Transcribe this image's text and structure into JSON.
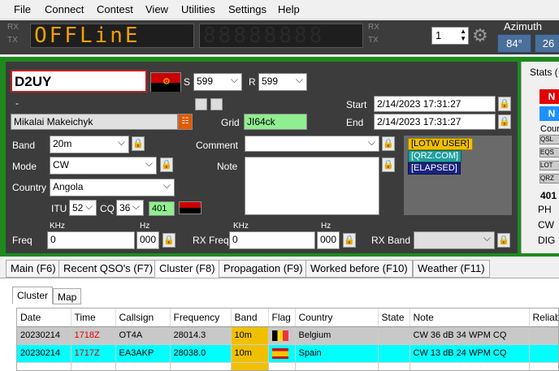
{
  "menu": [
    "File",
    "Connect",
    "Contest",
    "View",
    "Utilities",
    "Settings",
    "Help"
  ],
  "top": {
    "rx": "RX",
    "tx": "TX",
    "rx2": "RX",
    "tx2": "TX",
    "display": "OFFLinE",
    "radio_num": "1",
    "azimuth_label": "Azimuth",
    "azimuth_values": [
      "84°",
      "26"
    ]
  },
  "qso": {
    "callsign": "D2UY",
    "s_label": "S",
    "s_value": "599",
    "r_label": "R",
    "r_value": "599",
    "dash": "-",
    "name": "Mikalai Makeichyk",
    "grid_label": "Grid",
    "grid": "JI64ck",
    "start_label": "Start",
    "start": "2/14/2023 17:31:27",
    "end_label": "End",
    "end": "2/14/2023 17:31:27",
    "band_label": "Band",
    "band": "20m",
    "mode_label": "Mode",
    "mode": "CW",
    "country_label": "Country",
    "country": "Angola",
    "itu_label": "ITU",
    "itu": "52",
    "cq_label": "CQ",
    "cq": "36",
    "dxcc": "401",
    "comment_label": "Comment",
    "comment": "",
    "note_label": "Note",
    "tags": [
      "[LOTW USER]",
      "[QRZ.COM]",
      "[ELAPSED]"
    ],
    "tag_colors": [
      "#f0c000",
      "#20a0a0",
      "#1a237e"
    ],
    "khz": "KHz",
    "hz": "Hz",
    "freq_label": "Freq",
    "freq_khz": "0",
    "freq_hz": "000",
    "rxfreq_label": "RX Freq",
    "rxfreq_khz": "0",
    "rxfreq_hz": "000",
    "rxband_label": "RX Band"
  },
  "stats": {
    "title": "Stats (",
    "btn1": "N",
    "btn2": "N",
    "cour": "Cour",
    "labels": [
      "QSL",
      "EQS",
      "LOT",
      "QRZ"
    ],
    "count": "401",
    "modes": [
      "PH",
      "CW",
      "DIG"
    ]
  },
  "tabs": [
    "Main (F6)",
    "Recent QSO's (F7)",
    "Cluster (F8)",
    "Propagation (F9)",
    "Worked before (F10)",
    "Weather (F11)"
  ],
  "subtabs": [
    "Cluster",
    "Map"
  ],
  "table": {
    "headers": [
      "Date",
      "Time",
      "Callsign",
      "Frequency",
      "Band",
      "Flag",
      "Country",
      "State",
      "Note",
      "Reliabi"
    ],
    "rows": [
      {
        "date": "20230214",
        "time": "1718Z",
        "call": "OT4A",
        "freq": "28014.3",
        "band": "10m",
        "country": "Belgium",
        "state": "",
        "note": "CW 36 dB 34 WPM CQ",
        "bg": "#c8c8c8"
      },
      {
        "date": "20230214",
        "time": "1717Z",
        "call": "EA3AKP",
        "freq": "28038.0",
        "band": "10m",
        "country": "Spain",
        "state": "",
        "note": "CW 13 dB 24 WPM CQ",
        "bg": "#00ffff"
      }
    ]
  }
}
